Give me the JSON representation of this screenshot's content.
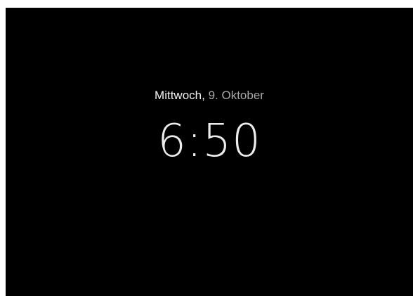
{
  "lockscreen": {
    "weekday": "Mittwoch,",
    "date": " 9. Oktober",
    "time": "6:50"
  },
  "colors": {
    "background": "#000000",
    "weekday_text": "#f2f2f2",
    "date_text": "#a9a9a9",
    "clock_text": "#ececec"
  }
}
